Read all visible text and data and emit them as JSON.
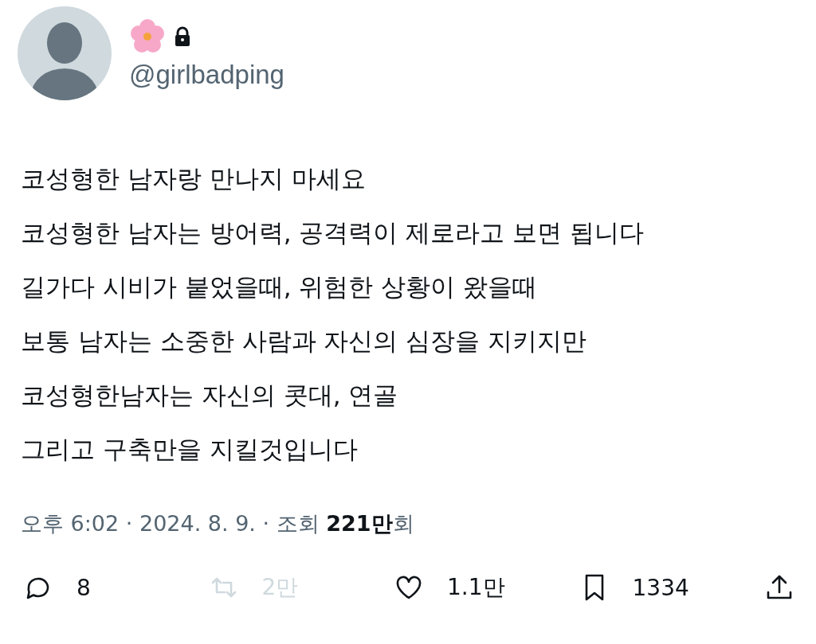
{
  "author": {
    "handle": "@girlbadping",
    "protected": true
  },
  "body": [
    "코성형한 남자랑 만나지 마세요",
    "코성형한 남자는 방어력, 공격력이 제로라고 보면 됩니다",
    "길가다 시비가 붙었을때, 위험한 상황이 왔을때",
    "보통 남자는 소중한 사람과 자신의 심장을 지키지만",
    "코성형한남자는 자신의 콧대, 연골",
    "그리고 구축만을 지킬것입니다"
  ],
  "meta": "오후 6:02 · 2024. 8. 9. · 조회 **221만**회",
  "actions": [
    {
      "kind": "reply",
      "count": "8",
      "disabled": false
    },
    {
      "kind": "repost",
      "count": "2만",
      "disabled": true
    },
    {
      "kind": "like",
      "count": "1.1만",
      "disabled": false
    },
    {
      "kind": "bookmark",
      "count": "1334",
      "disabled": false
    },
    {
      "kind": "share",
      "disabled": false
    }
  ]
}
